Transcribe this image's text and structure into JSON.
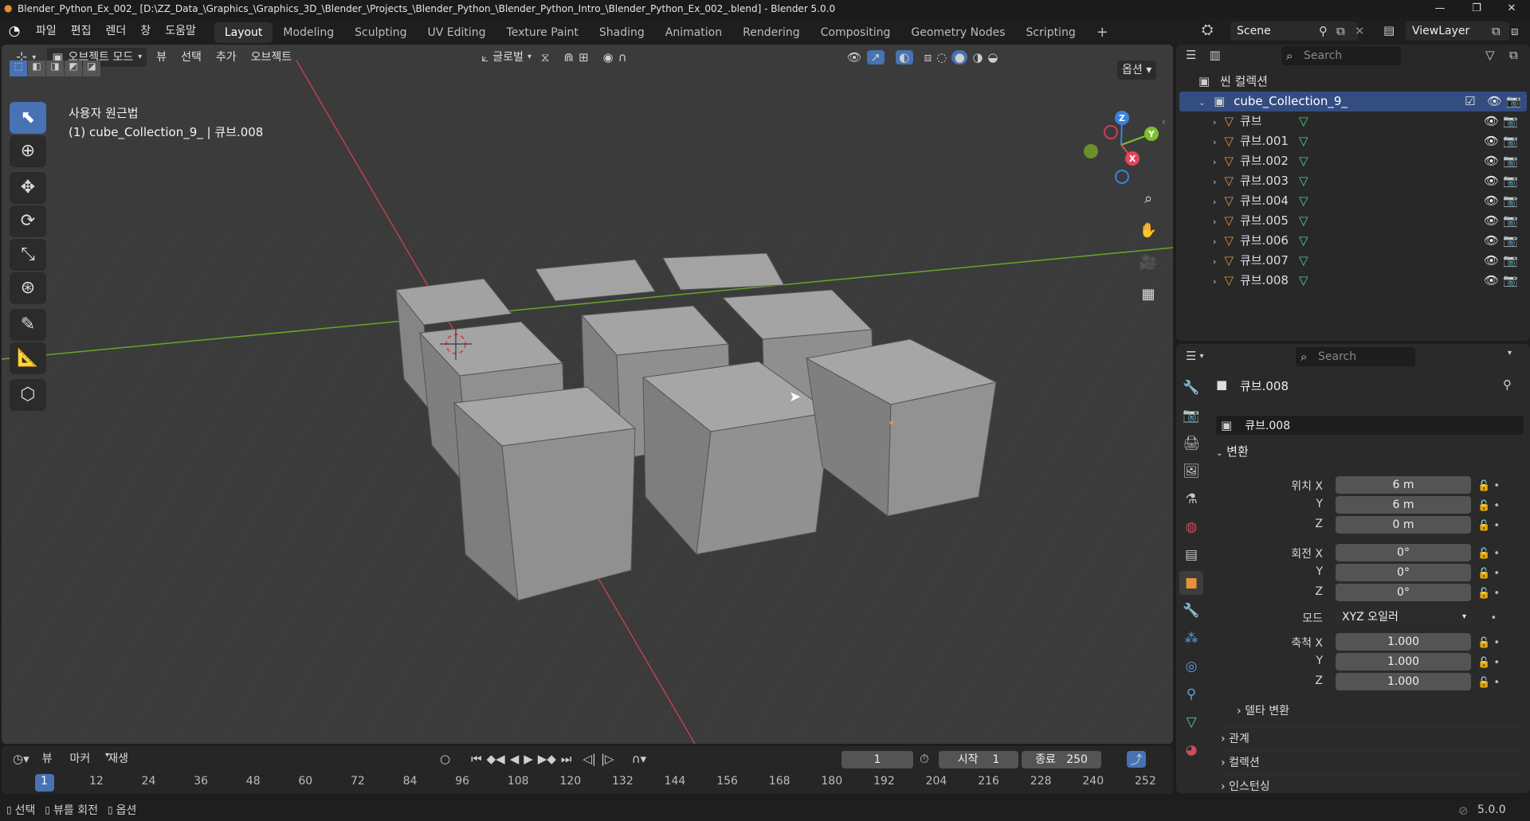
{
  "titlebar": {
    "title": "Blender_Python_Ex_002_ [D:\\ZZ_Data_\\Graphics_\\Graphics_3D_\\Blender_\\Projects_\\Blender_Python_\\Blender_Python_Intro_\\Blender_Python_Ex_002_.blend] - Blender 5.0.0"
  },
  "menu": [
    "파일",
    "편집",
    "렌더",
    "창",
    "도움말"
  ],
  "workspaces": [
    "Layout",
    "Modeling",
    "Sculpting",
    "UV Editing",
    "Texture Paint",
    "Shading",
    "Animation",
    "Rendering",
    "Compositing",
    "Geometry Nodes",
    "Scripting"
  ],
  "workspace_add": "+",
  "scene": {
    "name": "Scene",
    "viewlayer": "ViewLayer"
  },
  "viewport": {
    "mode": "오브젝트 모드",
    "menus": [
      "뷰",
      "선택",
      "추가",
      "오브젝트"
    ],
    "transform_orientation": "글로벌",
    "options_label": "옵션",
    "view_name": "사용자 원근법",
    "view_info": "(1) cube_Collection_9_ | 큐브.008",
    "gizmo": {
      "z": "Z",
      "y": "Y",
      "x": "X"
    }
  },
  "outliner": {
    "search_placeholder": "Search",
    "scene_collection": "씬 컬렉션",
    "collection": "cube_Collection_9_",
    "objects": [
      "큐브",
      "큐브.001",
      "큐브.002",
      "큐브.003",
      "큐브.004",
      "큐브.005",
      "큐브.006",
      "큐브.007",
      "큐브.008"
    ]
  },
  "properties": {
    "search_placeholder": "Search",
    "object_name": "큐브.008",
    "object_field": "큐브.008",
    "transform_section": "변환",
    "location": {
      "label": "위치 X",
      "x": "6 m",
      "y": "6 m",
      "z": "0 m"
    },
    "rotation": {
      "label": "회전 X",
      "x": "0°",
      "y": "0°",
      "z": "0°"
    },
    "mode_label": "모드",
    "mode_value": "XYZ 오일러",
    "scale": {
      "label": "축척 X",
      "x": "1.000",
      "y": "1.000",
      "z": "1.000"
    },
    "axis_y": "Y",
    "axis_z": "Z",
    "delta": "델타 변환",
    "sections": [
      "관계",
      "컬렉션",
      "인스턴싱"
    ]
  },
  "timeline": {
    "menus": [
      "뷰",
      "마커",
      "재생"
    ],
    "current_frame": "1",
    "start_label": "시작",
    "start": "1",
    "end_label": "종료",
    "end": "250",
    "frames": [
      "1",
      "12",
      "24",
      "36",
      "48",
      "60",
      "72",
      "84",
      "96",
      "108",
      "120",
      "132",
      "144",
      "156",
      "168",
      "180",
      "192",
      "204",
      "216",
      "228",
      "240",
      "252"
    ]
  },
  "statusbar": {
    "items": [
      "선택",
      "뷰를 회전",
      "옵션"
    ],
    "version": "5.0.0"
  },
  "colors": {
    "accent": "#4772b3",
    "x_axis": "#e0465b",
    "y_axis": "#7fbf2f",
    "z_axis": "#3a82e0",
    "object_orange": "#e8913a",
    "mesh_green": "#4fd18b"
  }
}
